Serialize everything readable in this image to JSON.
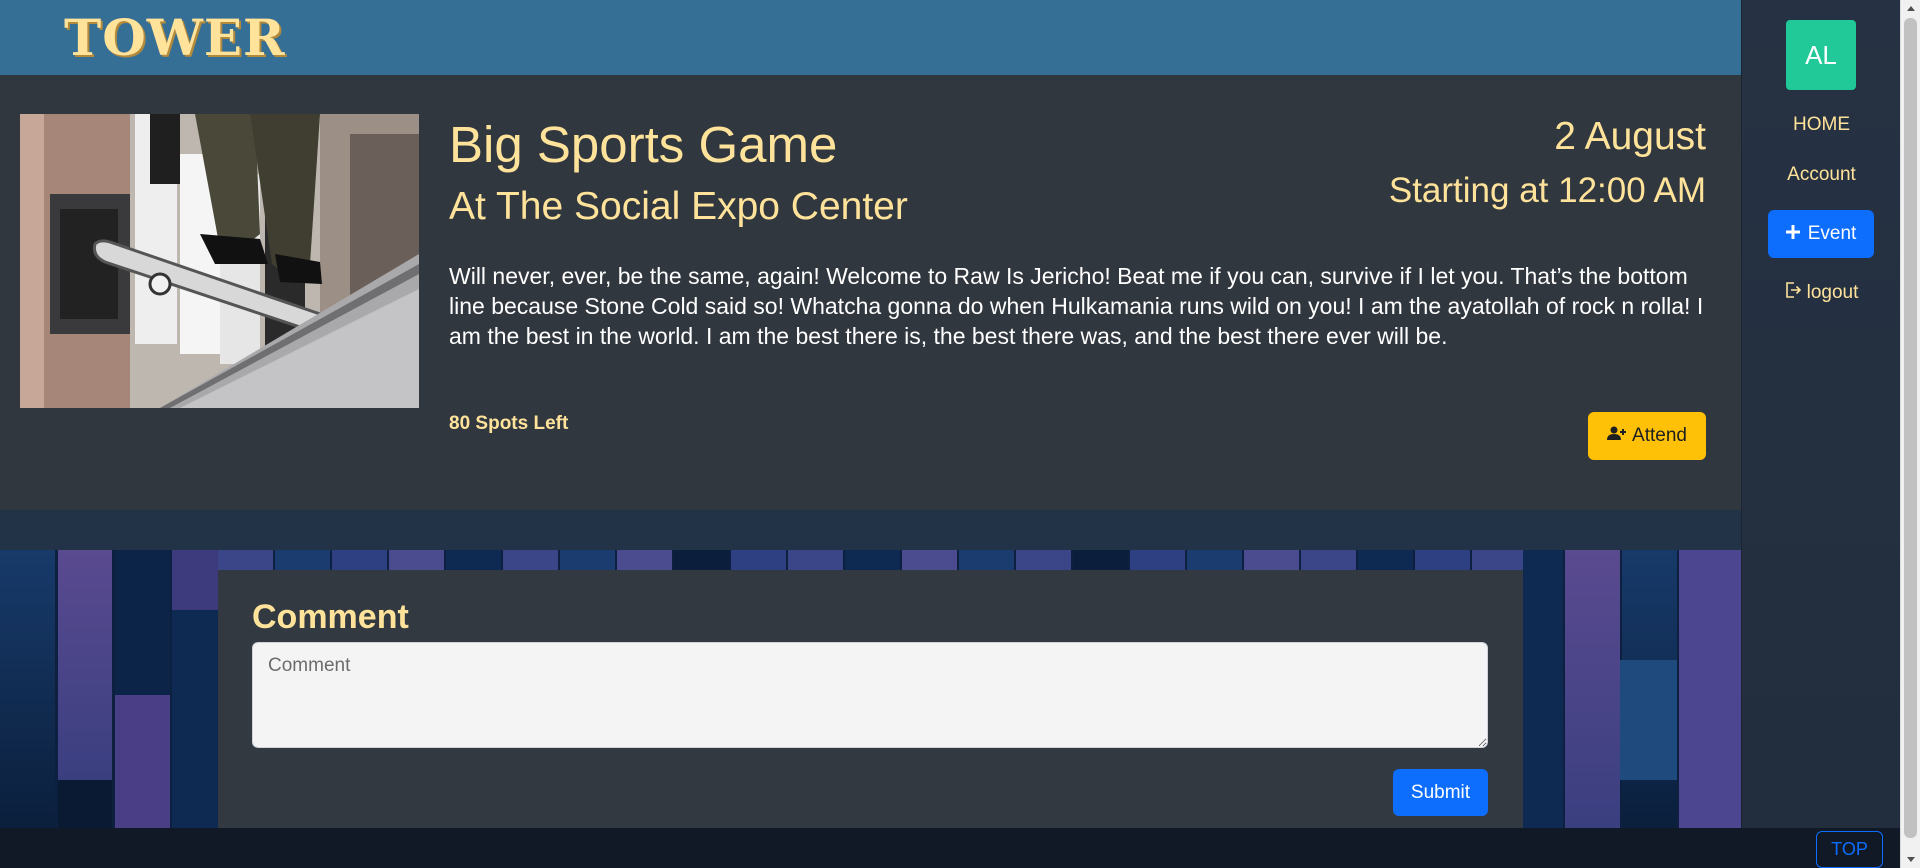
{
  "app": {
    "logo": "TOWER"
  },
  "event": {
    "title": "Big Sports Game",
    "location": "At The Social Expo Center",
    "date": "2 August",
    "time": "Starting at 12:00 AM",
    "description": "Will never, ever, be the same, again! Welcome to Raw Is Jericho! Beat me if you can, survive if I let you. That’s the bottom line because Stone Cold said so! Whatcha gonna do when Hulkamania runs wild on you! I am the ayatollah of rock n rolla! I am the best in the world. I am the best there is, the best there was, and the best there ever will be.",
    "spots_left": "80 Spots Left",
    "attend_label": "Attend",
    "image_icon": "skateboard-photo"
  },
  "comment": {
    "heading": "Comment",
    "placeholder": "Comment",
    "value": "",
    "submit_label": "Submit"
  },
  "sidebar": {
    "avatar_initials": "AL",
    "home_label": "HOME",
    "account_label": "Account",
    "event_button_label": "Event",
    "logout_label": "logout"
  },
  "footer": {
    "top_label": "TOP"
  },
  "colors": {
    "accent": "#ffe39a",
    "header": "#366f95",
    "panel": "#31373f",
    "primary": "#0d6efd",
    "warning": "#ffc107",
    "avatar": "#20c997"
  }
}
